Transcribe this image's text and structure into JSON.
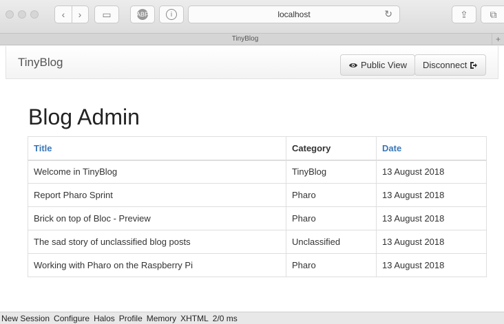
{
  "browser": {
    "address": "localhost",
    "tab_title": "TinyBlog",
    "new_tab": "+"
  },
  "navbar": {
    "brand": "TinyBlog",
    "public_view": "Public View",
    "disconnect": "Disconnect"
  },
  "page": {
    "heading": "Blog Admin"
  },
  "table": {
    "headers": {
      "title": "Title",
      "category": "Category",
      "date": "Date"
    },
    "rows": [
      {
        "title": "Welcome in TinyBlog",
        "category": "TinyBlog",
        "date": "13 August 2018"
      },
      {
        "title": "Report Pharo Sprint",
        "category": "Pharo",
        "date": "13 August 2018"
      },
      {
        "title": "Brick on top of Bloc - Preview",
        "category": "Pharo",
        "date": "13 August 2018"
      },
      {
        "title": "The sad story of unclassified blog posts",
        "category": "Unclassified",
        "date": "13 August 2018"
      },
      {
        "title": "Working with Pharo on the Raspberry Pi",
        "category": "Pharo",
        "date": "13 August 2018"
      }
    ]
  },
  "statusbar": {
    "new_session": "New Session",
    "configure": "Configure",
    "halos": "Halos",
    "profile": "Profile",
    "memory": "Memory",
    "xhtml": "XHTML",
    "timing": "2/0 ms"
  },
  "colors": {
    "link": "#3a77b8"
  },
  "icons": {
    "public_view": "eye-icon",
    "disconnect": "log-out-icon"
  }
}
